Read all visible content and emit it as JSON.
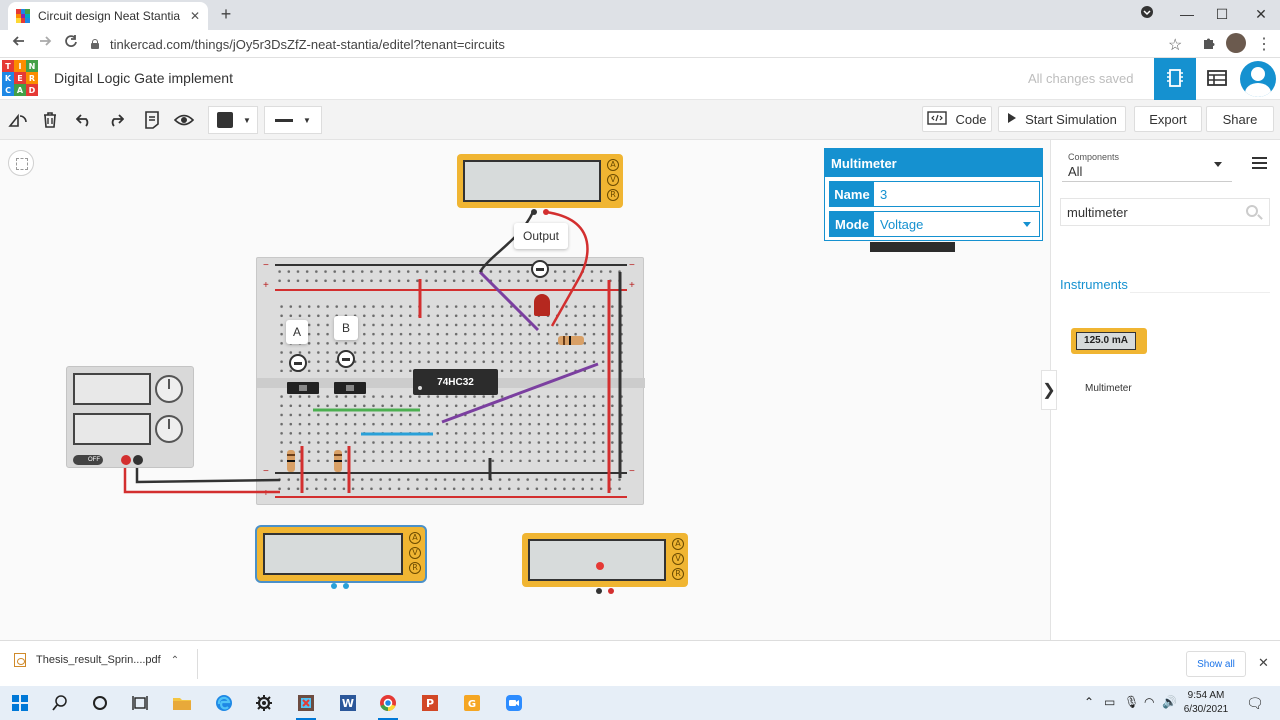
{
  "browser": {
    "tab_title": "Circuit design Neat Stantia | Tink",
    "tab_close": "✕",
    "new_tab": "+",
    "url": "tinkercad.com/things/jOy5r3DsZfZ-neat-stantia/editel?tenant=circuits",
    "window_controls": {
      "minimize": "—",
      "maximize": "☐",
      "close": "✕"
    }
  },
  "app": {
    "logo_letters": [
      "T",
      "I",
      "N",
      "K",
      "E",
      "R",
      "C",
      "A",
      "D"
    ],
    "design_title": "Digital Logic Gate implement",
    "save_status": "All changes saved"
  },
  "toolbar": {
    "code_label": "Code",
    "start_simulation_label": "Start Simulation",
    "export_label": "Export",
    "share_label": "Share",
    "wire_color": "#333333"
  },
  "circuit": {
    "ic_label": "74HC32",
    "probe_a": "A",
    "probe_b": "B",
    "probe_output": "Output",
    "meter_letters": [
      "A",
      "V",
      "R"
    ],
    "psu_off": "OFF"
  },
  "inspector": {
    "title": "Multimeter",
    "name_label": "Name",
    "name_value": "3",
    "mode_label": "Mode",
    "mode_value": "Voltage"
  },
  "components_panel": {
    "category_caption": "Components",
    "category_value": "All",
    "search_value": "multimeter",
    "section_title": "Instruments",
    "items": [
      {
        "display": "125.0 mA",
        "name": "Multimeter"
      }
    ]
  },
  "downloads": {
    "file_name": "Thesis_result_Sprin....pdf",
    "show_all": "Show all",
    "close": "✕"
  },
  "taskbar": {
    "time": "9:54 AM",
    "date": "6/30/2021"
  },
  "colors": {
    "accent": "#1591d0",
    "meter": "#f0b532",
    "wire_red": "#d32f2f",
    "wire_black": "#333333",
    "wire_purple": "#7b3fa0",
    "wire_green": "#4caf50",
    "wire_blue": "#29a0d8"
  }
}
